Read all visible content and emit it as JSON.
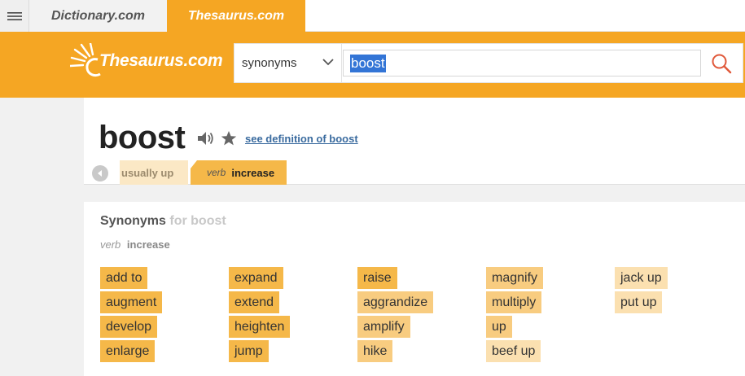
{
  "tabs": {
    "dictionary": "Dictionary.com",
    "thesaurus": "Thesaurus.com"
  },
  "header": {
    "logo": "Thesaurus.com",
    "search_type": "synonyms",
    "search_value": "boost"
  },
  "entry": {
    "word": "boost",
    "definition_link": "see definition of boost",
    "senses": [
      {
        "label": "usually up"
      },
      {
        "pos": "verb",
        "word": "increase"
      }
    ]
  },
  "synonyms": {
    "title": "Synonyms",
    "title_for": "for boost",
    "pos": "verb",
    "sense": "increase",
    "columns": [
      [
        "add to",
        "augment",
        "develop",
        "enlarge"
      ],
      [
        "expand",
        "extend",
        "heighten",
        "jump"
      ],
      [
        "raise",
        "aggrandize",
        "amplify",
        "hike"
      ],
      [
        "magnify",
        "multiply",
        "up",
        "beef up"
      ],
      [
        "jack up",
        "put up"
      ]
    ]
  },
  "colors": {
    "brand_orange": "#f5a623",
    "relevance_high": "#f5b849",
    "relevance_mid": "#f8cc80",
    "relevance_low": "#fbe0b0",
    "link": "#3a6b9f"
  }
}
